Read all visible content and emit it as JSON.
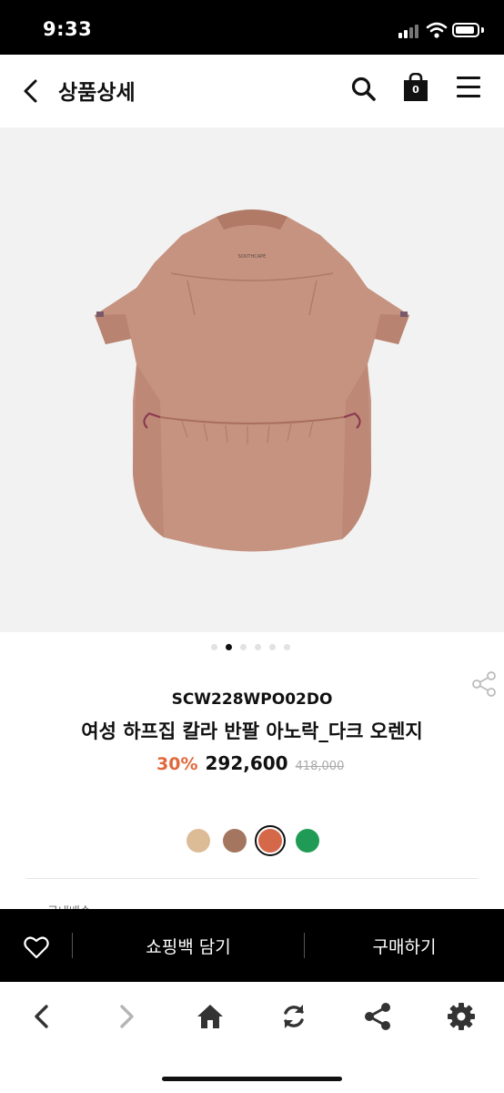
{
  "status": {
    "time": "9:33"
  },
  "header": {
    "title": "상품상세",
    "cart_count": "0"
  },
  "carousel": {
    "total": 6,
    "active_index": 1
  },
  "product": {
    "code": "SCW228WPO02DO",
    "name": "여성 하프집 칼라 반팔 아노락_다크 오렌지",
    "discount": "30%",
    "price": "292,600",
    "original_price": "418,000",
    "brand_print": "SOUTHCAPE",
    "colors": [
      "#dcbc96",
      "#a4765f",
      "#d6684a",
      "#1f9b55"
    ],
    "selected_color_index": 2
  },
  "peek": {
    "text": "국내배송"
  },
  "action_bar": {
    "add_to_bag": "쇼핑백 담기",
    "buy": "구매하기"
  },
  "icons": [
    "back-icon",
    "search-icon",
    "shopping-bag-icon",
    "menu-icon",
    "share-icon",
    "heart-icon",
    "chevron-left-icon",
    "chevron-right-icon",
    "home-icon",
    "refresh-icon",
    "gear-icon"
  ]
}
